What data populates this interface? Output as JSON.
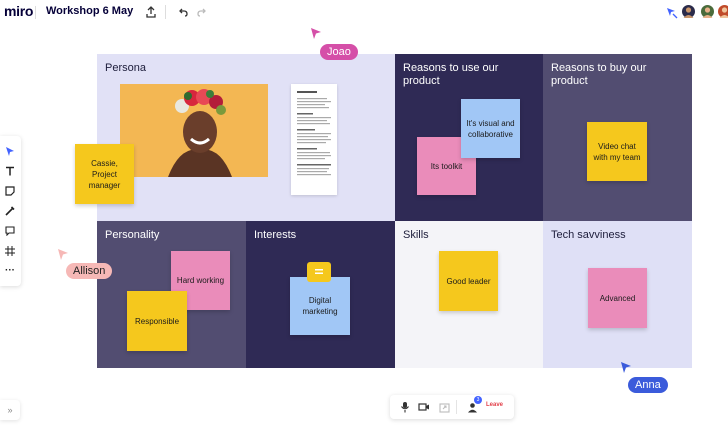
{
  "app": {
    "logo": "miro",
    "board_title": "Workshop 6 May"
  },
  "toolbar": {
    "tools": [
      {
        "name": "select-tool"
      },
      {
        "name": "text-tool"
      },
      {
        "name": "sticky-note-tool"
      },
      {
        "name": "pen-tool"
      },
      {
        "name": "comment-tool"
      },
      {
        "name": "frame-tool"
      },
      {
        "name": "more-tools"
      }
    ],
    "more_glyph": "···"
  },
  "board": {
    "persona": {
      "title": "Persona",
      "sticky": "Cassie, Project manager"
    },
    "reasons_use": {
      "title": "Reasons to use our product",
      "stickies": [
        "It's visual and collaborative",
        "Its toolkit"
      ]
    },
    "reasons_buy": {
      "title": "Reasons to buy our product",
      "sticky": "Video chat with my team"
    },
    "personality": {
      "title": "Personality",
      "stickies": [
        "Hard working",
        "Responsible"
      ]
    },
    "interests": {
      "title": "Interests",
      "sticky": "Digital marketing"
    },
    "skills": {
      "title": "Skills",
      "sticky": "Good leader"
    },
    "tech": {
      "title": "Tech savviness",
      "sticky": "Advanced"
    }
  },
  "cursors": [
    {
      "name": "Joao",
      "color": "#d54fa8"
    },
    {
      "name": "Allison",
      "color": "#f6b8b6"
    },
    {
      "name": "Anna",
      "color": "#3b5bdb"
    }
  ],
  "bottom_bar": {
    "leave_label": "Leave",
    "participants_badge": "3"
  },
  "expand_glyph": "»",
  "colors": {
    "light_cell": "#e1e1f6",
    "dark_cell": "#2f2a55",
    "mid_cell": "#524d71",
    "skills_cell": "#f4f4f8",
    "tech_cell": "#dfe0f6",
    "accent": "#4262ff"
  }
}
